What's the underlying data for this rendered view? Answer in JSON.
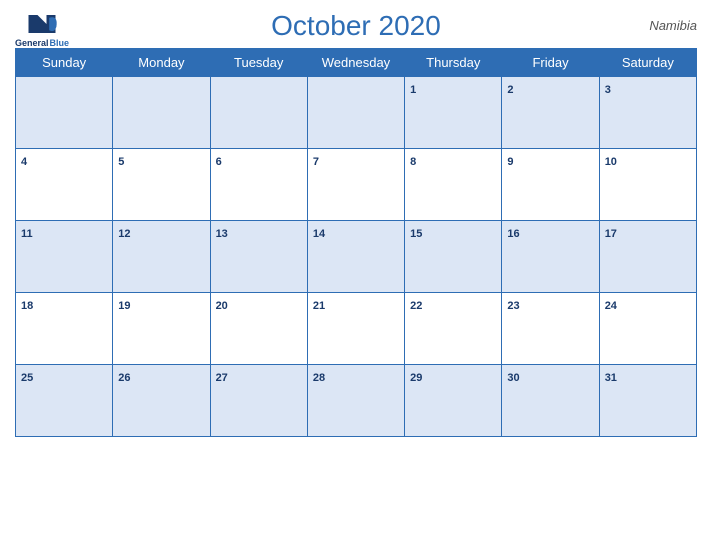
{
  "header": {
    "title": "October 2020",
    "country": "Namibia",
    "logo_line1": "General",
    "logo_line2": "Blue"
  },
  "weekdays": [
    "Sunday",
    "Monday",
    "Tuesday",
    "Wednesday",
    "Thursday",
    "Friday",
    "Saturday"
  ],
  "weeks": [
    [
      null,
      null,
      null,
      null,
      1,
      2,
      3
    ],
    [
      4,
      5,
      6,
      7,
      8,
      9,
      10
    ],
    [
      11,
      12,
      13,
      14,
      15,
      16,
      17
    ],
    [
      18,
      19,
      20,
      21,
      22,
      23,
      24
    ],
    [
      25,
      26,
      27,
      28,
      29,
      30,
      31
    ]
  ]
}
